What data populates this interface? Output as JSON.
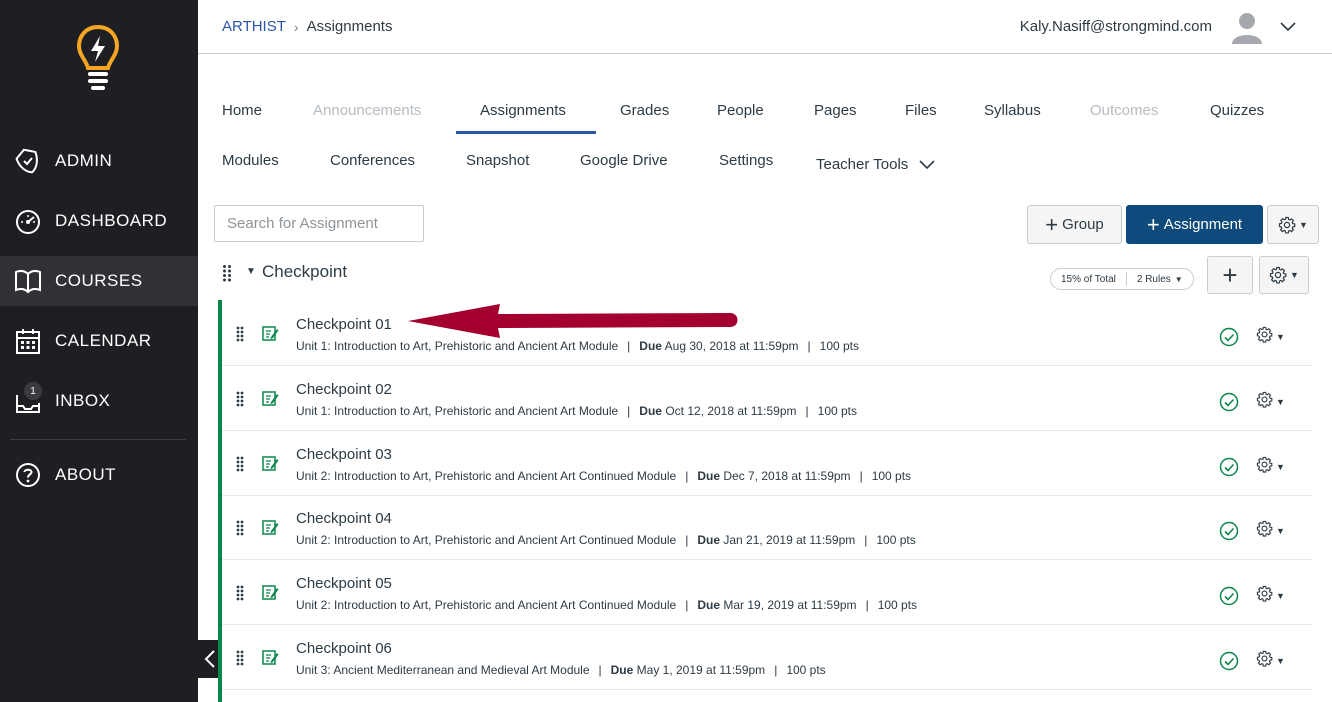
{
  "sidebar": {
    "items": [
      {
        "label": "ADMIN",
        "icon": "shield-icon"
      },
      {
        "label": "DASHBOARD",
        "icon": "dashboard-icon"
      },
      {
        "label": "COURSES",
        "icon": "book-icon"
      },
      {
        "label": "CALENDAR",
        "icon": "calendar-icon"
      },
      {
        "label": "INBOX",
        "icon": "inbox-icon",
        "badge": "1"
      },
      {
        "label": "ABOUT",
        "icon": "help-icon"
      }
    ],
    "active": "COURSES"
  },
  "header": {
    "breadcrumb_course": "ARTHIST",
    "breadcrumb_current": "Assignments",
    "user_email": "Kaly.Nasiff@strongmind.com"
  },
  "course_nav": {
    "row1": [
      "Home",
      "Announcements",
      "Assignments",
      "Grades",
      "People",
      "Pages",
      "Files",
      "Syllabus",
      "Outcomes",
      "Quizzes"
    ],
    "row2": [
      "Modules",
      "Conferences",
      "Snapshot",
      "Google Drive",
      "Settings",
      "Teacher Tools"
    ],
    "active": "Assignments",
    "disabled": [
      "Announcements",
      "Outcomes"
    ]
  },
  "toolbar": {
    "search_placeholder": "Search for Assignment",
    "group_button": "Group",
    "assignment_button": "Assignment"
  },
  "group": {
    "title": "Checkpoint",
    "weight": "15% of Total",
    "rules": "2 Rules"
  },
  "assignments": [
    {
      "title": "Checkpoint 01",
      "module": "Unit 1: Introduction to Art, Prehistoric and Ancient Art Module",
      "due_label": "Due",
      "due": "Aug 30, 2018 at 11:59pm",
      "points": "100 pts"
    },
    {
      "title": "Checkpoint 02",
      "module": "Unit 1: Introduction to Art, Prehistoric and Ancient Art Module",
      "due_label": "Due",
      "due": "Oct 12, 2018 at 11:59pm",
      "points": "100 pts"
    },
    {
      "title": "Checkpoint 03",
      "module": "Unit 2: Introduction to Art, Prehistoric and Ancient Art Continued Module",
      "due_label": "Due",
      "due": "Dec 7, 2018 at 11:59pm",
      "points": "100 pts"
    },
    {
      "title": "Checkpoint 04",
      "module": "Unit 2: Introduction to Art, Prehistoric and Ancient Art Continued Module",
      "due_label": "Due",
      "due": "Jan 21, 2019 at 11:59pm",
      "points": "100 pts"
    },
    {
      "title": "Checkpoint 05",
      "module": "Unit 2: Introduction to Art, Prehistoric and Ancient Art Continued Module",
      "due_label": "Due",
      "due": "Mar 19, 2019 at 11:59pm",
      "points": "100 pts"
    },
    {
      "title": "Checkpoint 06",
      "module": "Unit 3: Ancient Mediterranean and Medieval Art Module",
      "due_label": "Due",
      "due": "May 1, 2019 at 11:59pm",
      "points": "100 pts"
    }
  ],
  "colors": {
    "sidebar_bg": "#1e1f22",
    "link_blue": "#2b55a8",
    "primary_button": "#0e4a7c",
    "published_green": "#0b874b",
    "annotation_arrow": "#a3002f",
    "logo_orange": "#f6a623"
  }
}
